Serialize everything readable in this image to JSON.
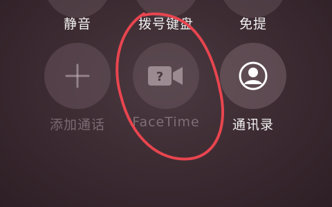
{
  "top_row": {
    "mute_label": "静音",
    "keypad_label": "拨号键盘",
    "speaker_label": "免提"
  },
  "middle_row": {
    "add_call_label": "添加通话",
    "facetime_label": "FaceTime",
    "contacts_label": "通讯录"
  },
  "icons": {
    "add_call": "plus-icon",
    "facetime": "facetime-unavailable-icon",
    "contacts": "contact-person-icon"
  },
  "colors": {
    "annotation": "#e8454f",
    "disabled_text": "#8f7d83",
    "enabled_text": "#f2f2f2"
  }
}
